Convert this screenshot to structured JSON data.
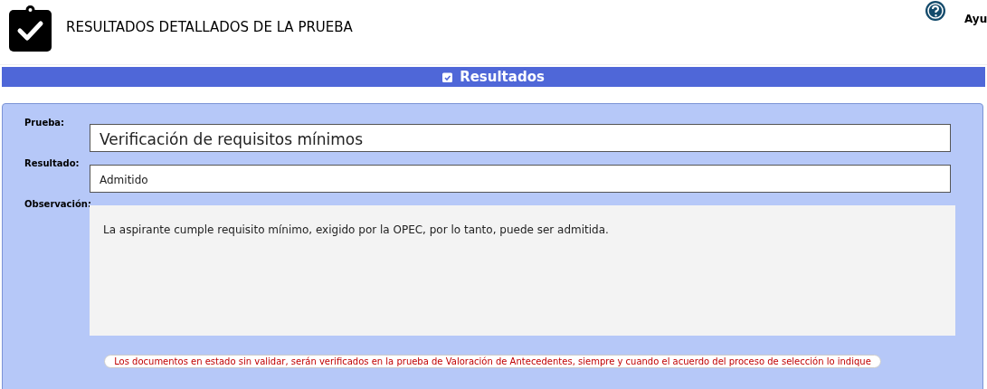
{
  "header": {
    "title": "RESULTADOS DETALLADOS DE LA PRUEBA",
    "help_label": "Ayu"
  },
  "section": {
    "title": "Resultados"
  },
  "fields": [
    {
      "label": "Prueba:",
      "value": "Verificación de requisitos mínimos",
      "kind": "large"
    },
    {
      "label": "Resultado:",
      "value": "Admitido",
      "kind": "small"
    },
    {
      "label": "Observación:",
      "value": "La aspirante cumple requisito mínimo, exigido por la OPEC, por lo tanto, puede ser admitida.",
      "kind": "area"
    }
  ],
  "note": "Los documentos en estado sin validar, serán verificados en la prueba de Valoración de Antecedentes, siempre y cuando el acuerdo del proceso de selección lo indique"
}
